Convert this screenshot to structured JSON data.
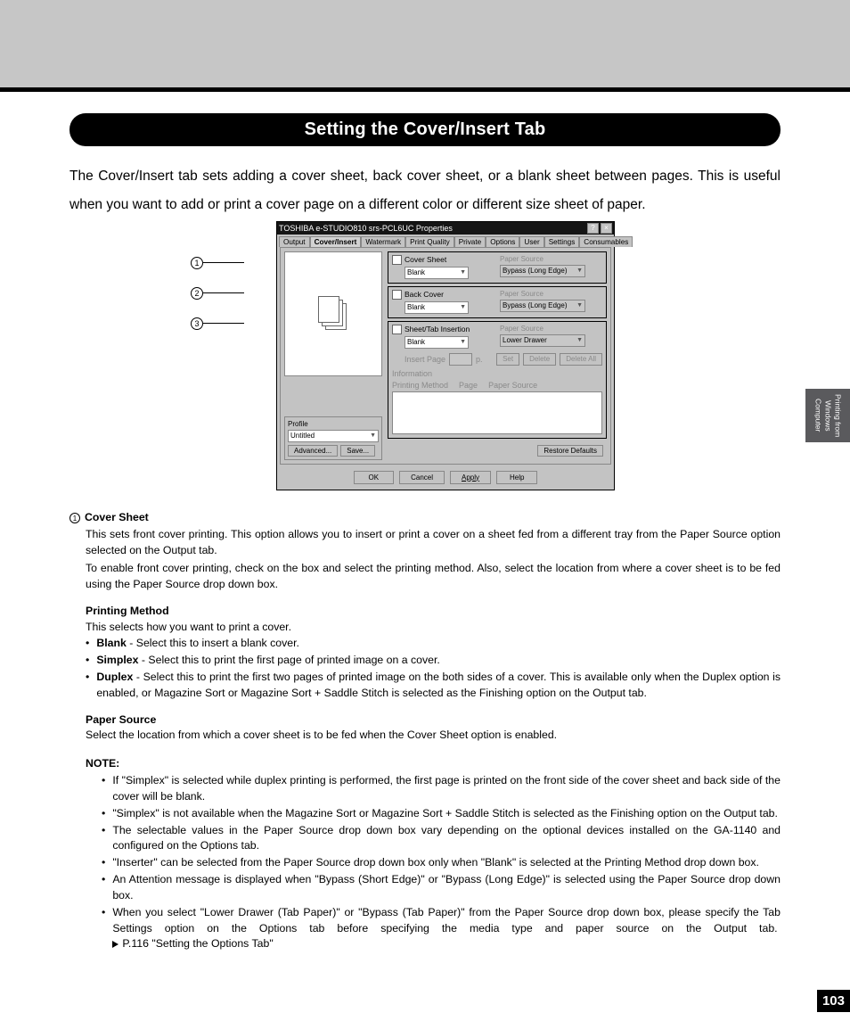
{
  "header_title": "Setting the Cover/Insert Tab",
  "intro": "The Cover/Insert tab sets adding a cover sheet, back cover sheet, or a blank sheet between pages. This is useful when you want to add or print a cover page on a different color or different size sheet of paper.",
  "callout_nums": [
    "1",
    "2",
    "3"
  ],
  "dialog": {
    "title": "TOSHIBA e-STUDIO810 srs-PCL6UC Properties",
    "tabs": [
      "Output",
      "Cover/Insert",
      "Watermark",
      "Print Quality",
      "Private",
      "Options",
      "User",
      "Settings",
      "Consumables"
    ],
    "cover_sheet": {
      "label": "Cover Sheet",
      "value": "Blank",
      "ps_label": "Paper Source",
      "ps_value": "Bypass (Long Edge)"
    },
    "back_cover": {
      "label": "Back Cover",
      "value": "Blank",
      "ps_label": "Paper Source",
      "ps_value": "Bypass (Long Edge)"
    },
    "insertion": {
      "label": "Sheet/Tab Insertion",
      "value": "Blank",
      "ps_label": "Paper Source",
      "ps_value": "Lower Drawer",
      "insert_page": "Insert Page",
      "p": "p.",
      "set": "Set",
      "delete": "Delete",
      "delete_all": "Delete All",
      "info": "Information",
      "method": "Printing Method",
      "page": "Page",
      "src": "Paper Source"
    },
    "profile": {
      "label": "Profile",
      "value": "Untitled",
      "adv": "Advanced...",
      "save": "Save..."
    },
    "restore": "Restore Defaults",
    "btns": [
      "OK",
      "Cancel",
      "Apply",
      "Help"
    ]
  },
  "item1": {
    "num": "1",
    "title": "Cover Sheet",
    "p1": "This sets front cover printing.  This option allows you to insert or print a cover on a sheet fed from a different tray from the Paper Source option selected on the Output tab.",
    "p2": "To enable front cover printing, check on the box and select the printing method.  Also, select the location from where a cover sheet is to be fed using the Paper Source drop down box.",
    "pm_head": "Printing Method",
    "pm_desc": "This selects how you want to print a cover.",
    "bullets": [
      {
        "b": "Blank",
        "t": " - Select this to insert a blank cover."
      },
      {
        "b": "Simplex",
        "t": " - Select this to print the first page of printed image on a cover."
      },
      {
        "b": "Duplex",
        "t": " - Select this to print the first two pages of printed image on the both sides of a cover.  This is available only when the Duplex option is enabled, or Magazine Sort or Magazine Sort + Saddle Stitch is selected as the Finishing option on the Output tab."
      }
    ],
    "ps_head": "Paper Source",
    "ps_desc": "Select the location from which a cover sheet is to be fed when the Cover Sheet option is enabled.",
    "note_head": "NOTE:",
    "notes": [
      "If \"Simplex\" is selected while duplex printing is performed, the first page is printed on the front side of the cover sheet and back side of the cover will be blank.",
      "\"Simplex\" is not available when the Magazine Sort or Magazine Sort + Saddle Stitch is selected as the Finishing option on the Output tab.",
      "The selectable values in the Paper Source drop down box vary depending on the optional devices installed on the GA-1140 and configured on the Options tab.",
      "\"Inserter\" can be selected from the Paper Source drop down box only when \"Blank\" is selected at the Printing Method drop down box.",
      "An Attention message is displayed when \"Bypass (Short Edge)\" or \"Bypass (Long Edge)\" is selected using the Paper Source drop down box.",
      "When you select \"Lower Drawer (Tab Paper)\" or \"Bypass (Tab Paper)\" from the Paper Source drop down box, please specify the Tab Settings option on the Options tab before specifying the media type and paper source on the Output tab."
    ],
    "ref": "P.116 \"Setting the Options Tab\""
  },
  "side_tab": "Printing from\nWindows Computer",
  "page_num": "103"
}
